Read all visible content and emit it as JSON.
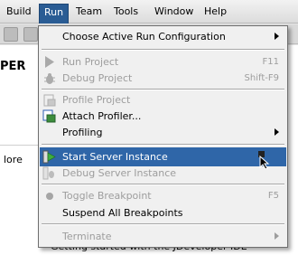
{
  "menubar": {
    "items": [
      {
        "label": "Build",
        "mnemonic": "B"
      },
      {
        "label": "Run",
        "mnemonic": "R"
      },
      {
        "label": "Team",
        "mnemonic": "m"
      },
      {
        "label": "Tools",
        "mnemonic": "T"
      },
      {
        "label": "Window",
        "mnemonic": "W"
      },
      {
        "label": "Help",
        "mnemonic": "H"
      }
    ],
    "active": "Run"
  },
  "background": {
    "heading": "PER",
    "more_text": "lore",
    "link_text": "Getting started with the JDeveloper IDE"
  },
  "run_menu": {
    "items": [
      {
        "label": "Choose Active Run Configuration",
        "shortcut": "",
        "enabled": true,
        "submenu": true,
        "icon": ""
      },
      {
        "label": "Run Project",
        "shortcut": "F11",
        "enabled": false,
        "submenu": false,
        "icon": "run-icon"
      },
      {
        "label": "Debug Project",
        "shortcut": "Shift-F9",
        "enabled": false,
        "submenu": false,
        "icon": "debug-icon"
      },
      {
        "label": "Profile Project",
        "shortcut": "",
        "enabled": false,
        "submenu": false,
        "icon": "profile-icon"
      },
      {
        "label": "Attach Profiler...",
        "shortcut": "",
        "enabled": true,
        "submenu": false,
        "icon": "attach-profiler-icon"
      },
      {
        "label": "Profiling",
        "shortcut": "",
        "enabled": true,
        "submenu": true,
        "icon": ""
      },
      {
        "label": "Start Server Instance",
        "shortcut": "",
        "enabled": true,
        "submenu": false,
        "icon": "start-server-icon",
        "highlighted": true
      },
      {
        "label": "Debug Server Instance",
        "shortcut": "",
        "enabled": false,
        "submenu": false,
        "icon": "debug-server-icon"
      },
      {
        "label": "Toggle Breakpoint",
        "shortcut": "F5",
        "enabled": false,
        "submenu": false,
        "icon": "breakpoint-icon"
      },
      {
        "label": "Suspend All Breakpoints",
        "shortcut": "",
        "enabled": true,
        "submenu": false,
        "icon": ""
      },
      {
        "label": "Terminate",
        "shortcut": "",
        "enabled": false,
        "submenu": true,
        "icon": ""
      }
    ]
  },
  "colors": {
    "menu_highlight": "#2f66a8",
    "disabled_text": "#9d9d9d",
    "menu_background": "#f0f0f0"
  }
}
